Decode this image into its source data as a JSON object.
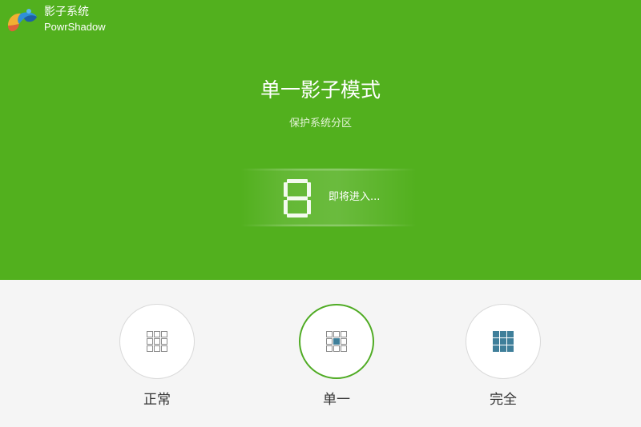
{
  "app": {
    "name_cn": "影子系统",
    "name_en": "PowrShadow"
  },
  "banner": {
    "title": "单一影子模式",
    "subtitle": "保护系统分区",
    "countdown_value": "8",
    "countdown_text": "即将进入..."
  },
  "modes": [
    {
      "label": "正常",
      "icon": "grid-outline-icon",
      "selected": false
    },
    {
      "label": "单一",
      "icon": "grid-center-filled-icon",
      "selected": true
    },
    {
      "label": "完全",
      "icon": "grid-all-filled-icon",
      "selected": false
    }
  ],
  "colors": {
    "banner_bg": "#52b01e",
    "bottom_bg": "#f5f5f5",
    "selected_ring": "#4fab23",
    "icon_outline": "#8a8a8a",
    "icon_fill": "#3f7f9a"
  }
}
